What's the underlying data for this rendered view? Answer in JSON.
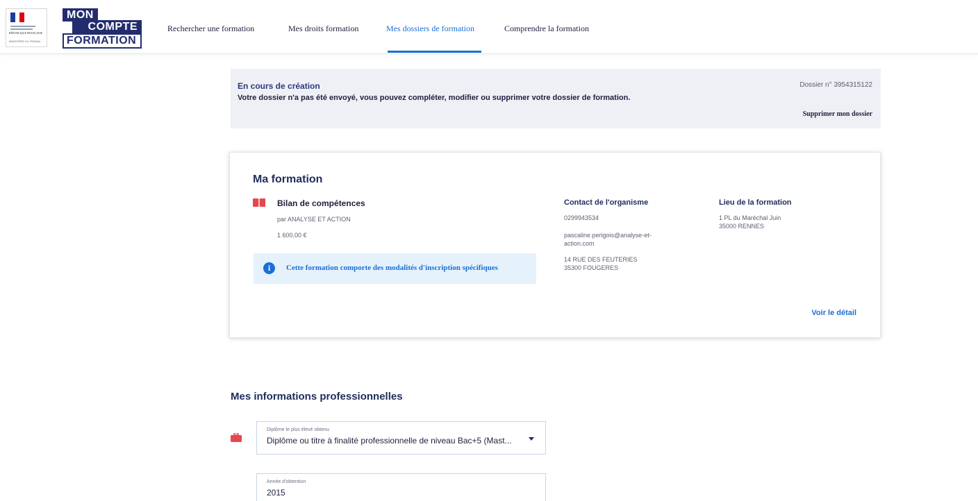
{
  "header": {
    "marianne": {
      "republic_text": "RÉPUBLIQUE FRANÇAISE",
      "ministry_text": "MINISTÈRE DU TRAVAIL"
    },
    "logo": {
      "line1": "MON",
      "line2": "COMPTE",
      "line3": "FORMATION"
    },
    "nav": [
      {
        "label": "Rechercher une formation",
        "active": false
      },
      {
        "label": "Mes droits formation",
        "active": false
      },
      {
        "label": "Mes dossiers de formation",
        "active": true
      },
      {
        "label": "Comprendre la formation",
        "active": false
      }
    ]
  },
  "status": {
    "title": "En cours de création",
    "description": "Votre dossier n'a pas été envoyé, vous pouvez compléter, modifier ou supprimer votre dossier de formation.",
    "dossier_number": "Dossier n° 3954315122",
    "delete_label": "Supprimer mon dossier"
  },
  "formation": {
    "heading": "Ma formation",
    "name": "Bilan de compétences",
    "organisme": "par ANALYSE ET ACTION",
    "price": "1 600,00 €",
    "info_message": "Cette formation comporte des modalités d'inscription spécifiques",
    "contact": {
      "title": "Contact de l'organisme",
      "phone": "0299943534",
      "email_line1": "pascaline.perigois@analyse-et-",
      "email_line2": "action.com",
      "address_line1": "14 RUE DES FEUTERIES",
      "address_line2": "35300 FOUGERES"
    },
    "lieu": {
      "title": "Lieu de la formation",
      "address_line1": "1 PL du Maréchal Juin",
      "address_line2": "35000 RENNES"
    },
    "detail_link": "Voir le détail"
  },
  "pro_info": {
    "heading": "Mes informations professionnelles",
    "diploma": {
      "label": "Diplôme le plus élevé obtenu",
      "value": "Diplôme ou titre à finalité professionnelle de niveau Bac+5 (Mast..."
    },
    "year": {
      "label": "Année d'obtention",
      "value": "2015"
    }
  },
  "colors": {
    "navy": "#232d6e",
    "accent_blue": "#1a6fd6",
    "banner_bg": "#eef0f5",
    "info_bg": "#e5f1fb",
    "icon_red": "#e5474f"
  },
  "icons": {
    "course": "book-icon",
    "info": "info-icon",
    "pro": "briefcase-icon",
    "select": "caret-down-icon"
  }
}
